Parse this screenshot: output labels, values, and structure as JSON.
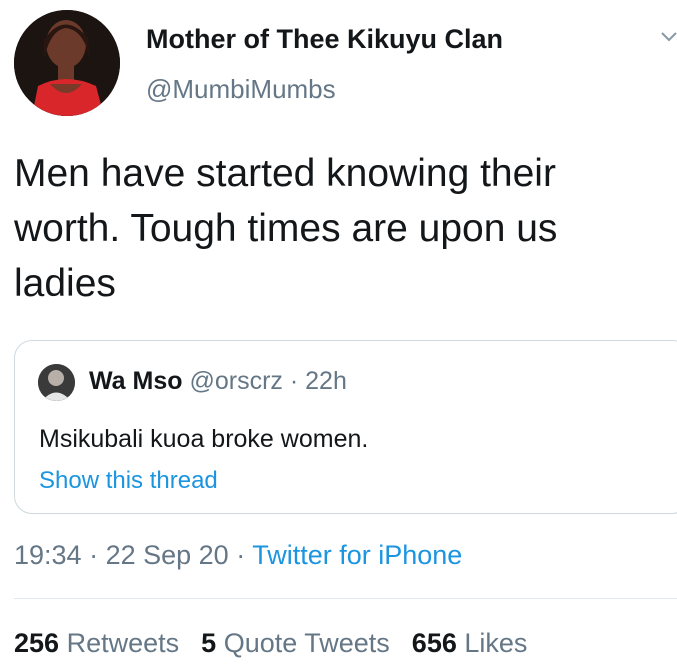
{
  "author": {
    "display_name": "Mother of Thee Kikuyu Clan",
    "handle": "@MumbiMumbs"
  },
  "tweet": {
    "text": "Men have started knowing their worth. Tough times are upon us ladies"
  },
  "quoted_tweet": {
    "name": "Wa Mso",
    "handle": "@orscrz",
    "time": "22h",
    "separator": " · ",
    "text": "Msikubali kuoa broke women.",
    "show_thread": "Show this thread"
  },
  "meta": {
    "time": "19:34",
    "date": "22 Sep 20",
    "separator": " · ",
    "source": "Twitter for iPhone"
  },
  "stats": {
    "retweets_count": "256",
    "retweets_label": "Retweets",
    "quotes_count": "5",
    "quotes_label": "Quote Tweets",
    "likes_count": "656",
    "likes_label": "Likes"
  },
  "colors": {
    "accent": "#1b95e0",
    "secondary_text": "#657786",
    "primary_text": "#14171a"
  },
  "icons": {
    "menu": "chevron-down-icon"
  }
}
